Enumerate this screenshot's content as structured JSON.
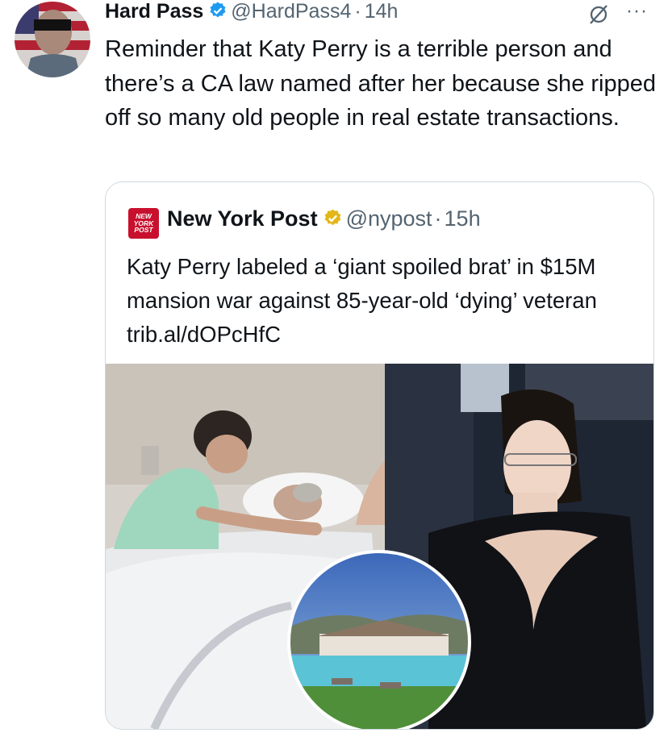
{
  "tweet": {
    "author": "Hard Pass",
    "handle": "@HardPass4",
    "separator": "·",
    "time": "14h",
    "more": "···",
    "text": "Reminder that Katy Perry is a terrible person and there’s a CA law named after her because she ripped off so many old people in real estate transactions."
  },
  "quote": {
    "logo_text": [
      "NEW",
      "YORK",
      "POST"
    ],
    "author": "New York Post",
    "handle": "@nypost",
    "separator": "·",
    "time": "15h",
    "text": "Katy Perry labeled a ‘giant spoiled brat’ in $15M mansion war against 85-year-old ‘dying’ veteran trib.al/dOPcHfC"
  },
  "colors": {
    "verified_blue": "#1d9bf0",
    "verified_gold": "#e2b719",
    "secondary_text": "#536471",
    "border": "#cfd9de",
    "nyp_red": "#c8102e"
  },
  "icons": [
    "verified-badge-icon",
    "gold-verified-badge-icon",
    "grok-icon",
    "more-options-icon"
  ]
}
